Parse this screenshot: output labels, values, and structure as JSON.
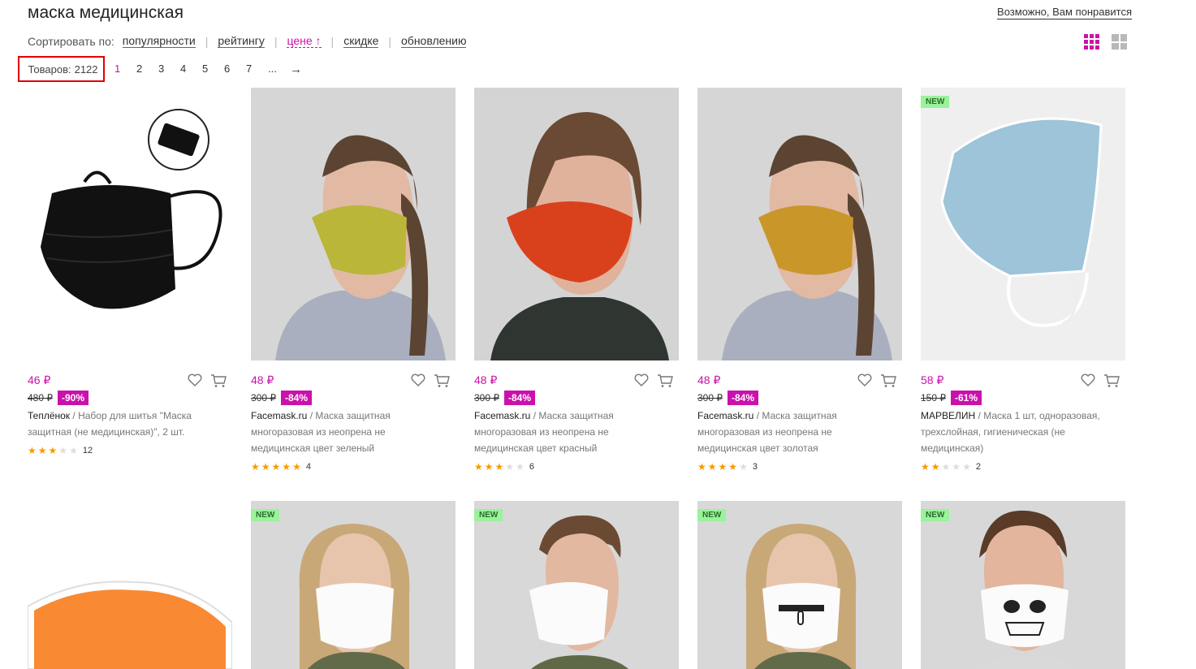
{
  "page": {
    "title": "маска медицинская",
    "recommend_link": "Возможно, Вам понравится"
  },
  "sort": {
    "label": "Сортировать по:",
    "options": [
      "популярности",
      "рейтингу",
      "цене ↑",
      "скидке",
      "обновлению"
    ],
    "active_index": 2
  },
  "view_toggle": {
    "active": "grid-3"
  },
  "pager": {
    "count_label": "Товаров:",
    "count_value": "2122",
    "pages": [
      "1",
      "2",
      "3",
      "4",
      "5",
      "6",
      "7",
      "...",
      "→"
    ],
    "current": "1"
  },
  "accent_color": "#cb11ab",
  "products": [
    {
      "price": "46 ₽",
      "old_price": "480 ₽",
      "discount": "-90%",
      "brand": "Теплёнок",
      "name": " / Набор для шитья \"Маска защитная (не медицинская)\", 2 шт.",
      "rating": 3,
      "reviews": "12",
      "new": false
    },
    {
      "price": "48 ₽",
      "old_price": "300 ₽",
      "discount": "-84%",
      "brand": "Facemask.ru",
      "name": " / Маска защитная многоразовая из неопрена не медицинская цвет зеленый",
      "rating": 5,
      "reviews": "4",
      "new": false
    },
    {
      "price": "48 ₽",
      "old_price": "300 ₽",
      "discount": "-84%",
      "brand": "Facemask.ru",
      "name": " / Маска защитная многоразовая из неопрена не медицинская цвет красный",
      "rating": 3,
      "reviews": "6",
      "new": false
    },
    {
      "price": "48 ₽",
      "old_price": "300 ₽",
      "discount": "-84%",
      "brand": "Facemask.ru",
      "name": " / Маска защитная многоразовая из неопрена не медицинская цвет золотая",
      "rating": 4,
      "reviews": "3",
      "new": false
    },
    {
      "price": "58 ₽",
      "old_price": "150 ₽",
      "discount": "-61%",
      "brand": "МАРВЕЛИН",
      "name": " / Маска 1 шт, одноразовая, трехслойная, гигиеническая (не медицинская)",
      "rating": 2,
      "reviews": "2",
      "new": true,
      "badge": "NEW"
    },
    {
      "new": false
    },
    {
      "new": true,
      "badge": "NEW"
    },
    {
      "new": true,
      "badge": "NEW"
    },
    {
      "new": true,
      "badge": "NEW"
    },
    {
      "new": true,
      "badge": "NEW"
    }
  ]
}
